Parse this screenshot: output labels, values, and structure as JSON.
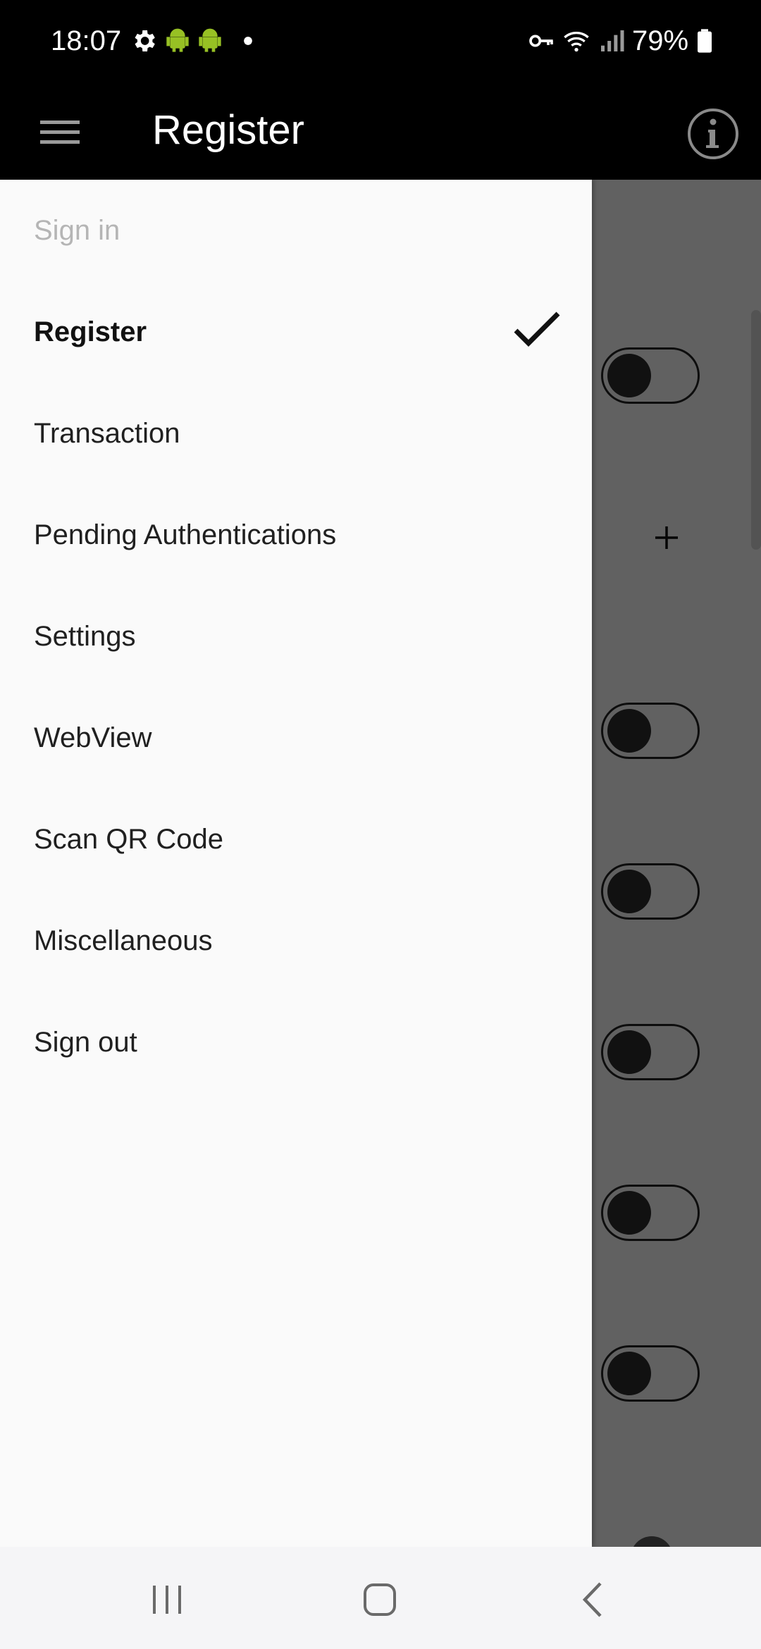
{
  "status_bar": {
    "time": "18:07",
    "battery": "79%",
    "icons": [
      "settings-gear-icon",
      "android-icon",
      "android-icon",
      "dot-icon",
      "vpn-key-icon",
      "wifi-icon",
      "signal-icon",
      "battery-icon"
    ],
    "android_color": "#97c024"
  },
  "app_bar": {
    "title": "Register",
    "menu_icon": "hamburger-menu-icon",
    "info_icon": "info-icon"
  },
  "drawer": {
    "header": "Sign in",
    "items": [
      {
        "label": "Register",
        "selected": true
      },
      {
        "label": "Transaction"
      },
      {
        "label": "Pending Authentications"
      },
      {
        "label": "Settings"
      },
      {
        "label": "WebView"
      },
      {
        "label": "Scan QR Code"
      },
      {
        "label": "Miscellaneous"
      },
      {
        "label": "Sign out"
      }
    ]
  },
  "content": {
    "toggles": [
      false,
      false,
      false,
      false,
      false,
      false
    ]
  },
  "system_nav": {
    "buttons": [
      "recent-apps-icon",
      "home-icon",
      "back-icon"
    ]
  }
}
